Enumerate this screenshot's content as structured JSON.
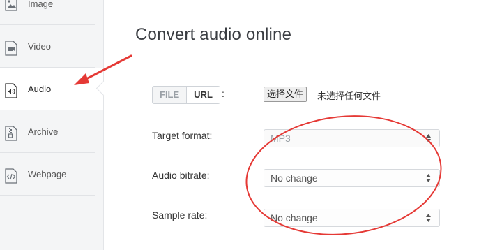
{
  "sidebar": {
    "items": [
      {
        "label": "Image",
        "icon": "image-file-icon"
      },
      {
        "label": "Video",
        "icon": "video-file-icon"
      },
      {
        "label": "Audio",
        "icon": "audio-file-icon",
        "active": true
      },
      {
        "label": "Archive",
        "icon": "archive-file-icon"
      },
      {
        "label": "Webpage",
        "icon": "code-file-icon"
      }
    ]
  },
  "main": {
    "title": "Convert audio online",
    "source_tabs": [
      {
        "label": "FILE"
      },
      {
        "label": "URL",
        "active": true
      }
    ],
    "source_colon": ":",
    "file_button_label": "选择文件",
    "file_status": "未选择任何文件",
    "fields": [
      {
        "label": "Target format:",
        "value": "MP3",
        "disabled": true
      },
      {
        "label": "Audio bitrate:",
        "value": "No change"
      },
      {
        "label": "Sample rate:",
        "value": "No change"
      }
    ]
  },
  "annotations": {
    "arrow_color": "#e53935",
    "ellipse_color": "#e53935"
  }
}
